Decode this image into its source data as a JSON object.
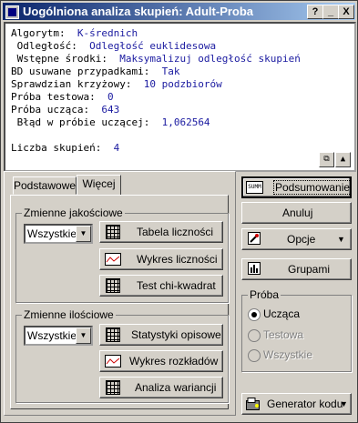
{
  "window": {
    "title": "Uogólniona analiza skupień: Adult-Proba",
    "help_label": "?",
    "minimize_label": "_",
    "close_label": "X"
  },
  "output": {
    "lines": [
      {
        "label": "Algorytm:  ",
        "value": "K-średnich"
      },
      {
        "label": " Odległość:  ",
        "value": "Odległość euklidesowa"
      },
      {
        "label": " Wstępne środki:  ",
        "value": "Maksymalizuj odległość skupień"
      },
      {
        "label": "BD usuwane przypadkami:  ",
        "value": "Tak"
      },
      {
        "label": "Sprawdzian krzyżowy:  ",
        "value": "10 podzbiorów"
      },
      {
        "label": "Próba testowa:  ",
        "value": "0"
      },
      {
        "label": "Próba ucząca:  ",
        "value": "643"
      },
      {
        "label": " Błąd w próbie uczącej:  ",
        "value": "1,062564"
      },
      {
        "label": "Liczba skupień:  ",
        "value": "4"
      }
    ]
  },
  "tabs": {
    "basic": "Podstawowe",
    "more": "Więcej"
  },
  "qualitative": {
    "title": "Zmienne jakościowe",
    "select_value": "Wszystkie",
    "buttons": {
      "freq_table": "Tabela liczności",
      "freq_chart": "Wykres liczności",
      "chi_test": "Test chi-kwadrat"
    }
  },
  "quantitative": {
    "title": "Zmienne ilościowe",
    "select_value": "Wszystkie",
    "buttons": {
      "descriptive": "Statystyki opisowe",
      "distributions": "Wykres rozkładów",
      "anova": "Analiza wariancji"
    }
  },
  "right": {
    "summary": "Podsumowanie",
    "summary_icon_text": "SUMM",
    "cancel": "Anuluj",
    "options": "Opcje",
    "groups": "Grupami",
    "code_gen": "Generator kodu"
  },
  "sample": {
    "title": "Próba",
    "options": [
      "Ucząca",
      "Testowa",
      "Wszystkie"
    ],
    "selected": "Ucząca"
  },
  "colors": {
    "title_start": "#0a246a",
    "title_end": "#a6caf0",
    "value_text": "#1a1aa0"
  }
}
